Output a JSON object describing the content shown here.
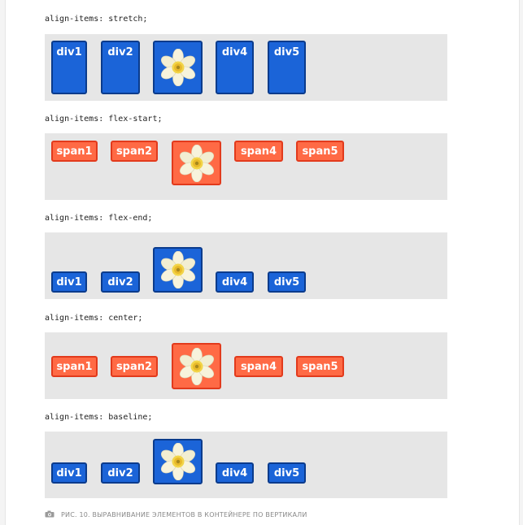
{
  "rows": [
    {
      "label": "align-items: stretch;",
      "items": [
        "div1",
        "div2",
        "",
        "div4",
        "div5"
      ]
    },
    {
      "label": "align-items: flex-start;",
      "items": [
        "span1",
        "span2",
        "",
        "span4",
        "span5"
      ]
    },
    {
      "label": "align-items: flex-end;",
      "items": [
        "div1",
        "div2",
        "",
        "div4",
        "div5"
      ]
    },
    {
      "label": "align-items: center;",
      "items": [
        "span1",
        "span2",
        "",
        "span4",
        "span5"
      ]
    },
    {
      "label": "align-items: baseline;",
      "items": [
        "div1",
        "div2",
        "",
        "div4",
        "div5"
      ]
    }
  ],
  "caption": {
    "icon": "camera-icon",
    "text": "РИС. 10. ВЫРАВНИВАНИЕ ЭЛЕМЕНТОВ В КОНТЕЙНЕРЕ ПО ВЕРТИКАЛИ"
  },
  "colors": {
    "blue": "#1b64d8",
    "blue_border": "#0a3b8c",
    "orange": "#ff6a45",
    "orange_border": "#e23a1c",
    "panel": "#e6e6e6"
  }
}
